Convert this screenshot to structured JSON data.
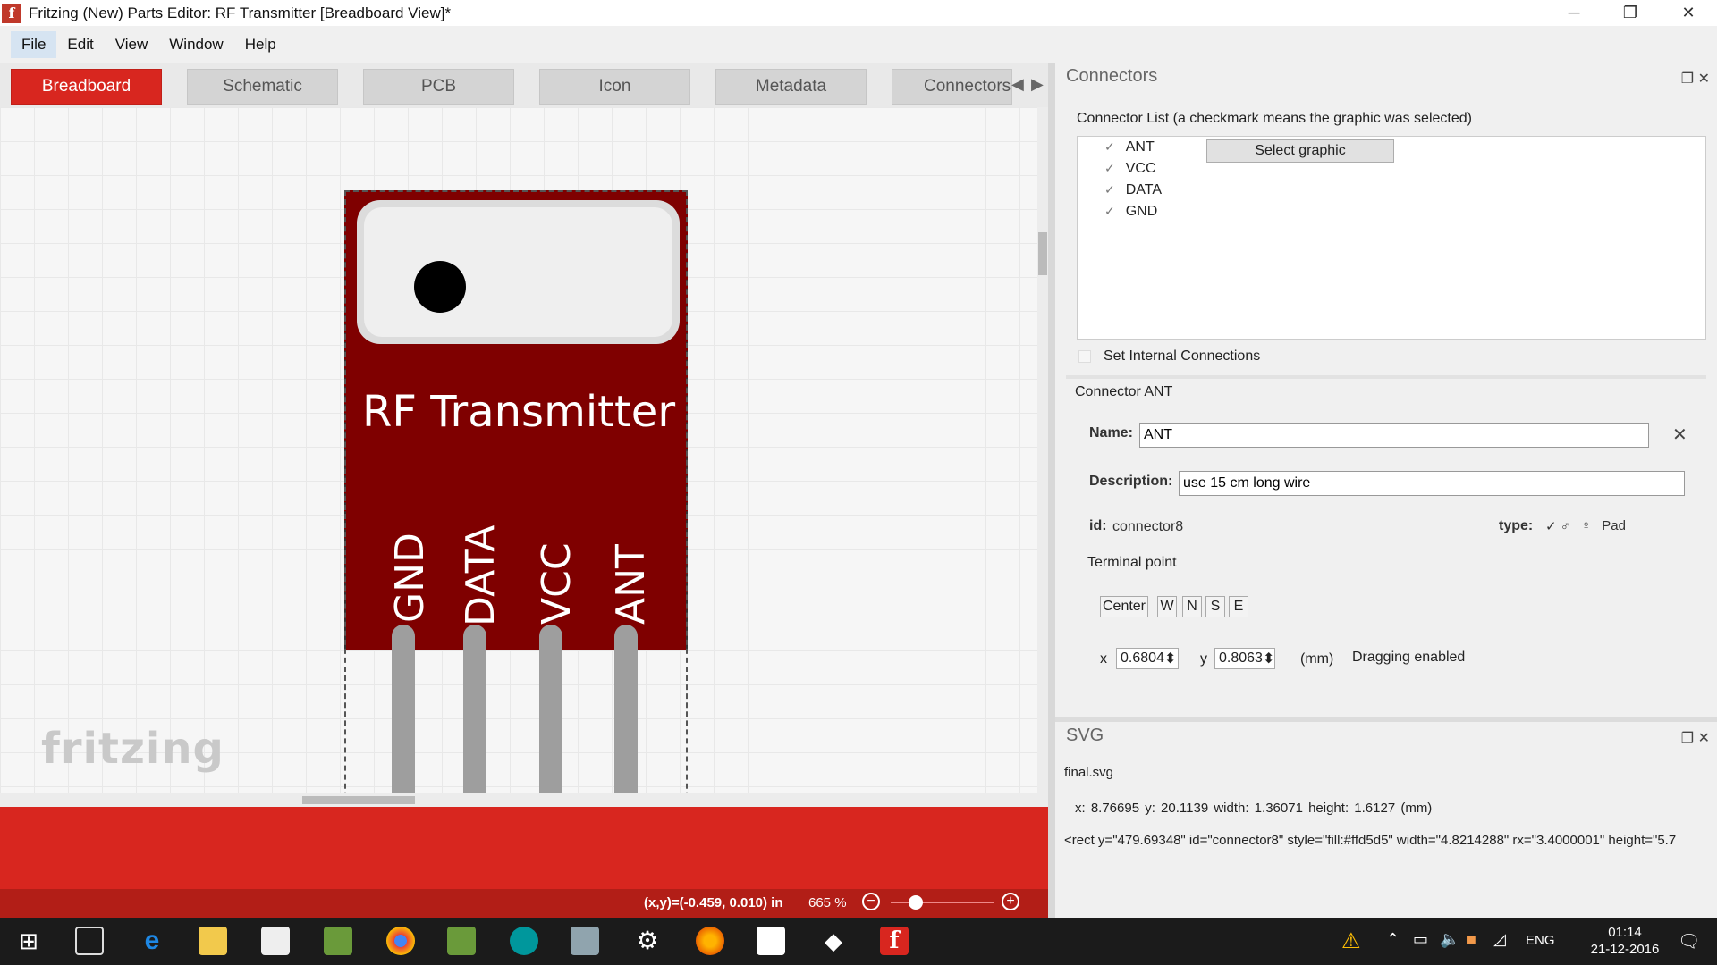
{
  "window": {
    "title": "Fritzing (New) Parts Editor: RF Transmitter [Breadboard View]*",
    "app_icon": "f"
  },
  "menu": [
    "File",
    "Edit",
    "View",
    "Window",
    "Help"
  ],
  "tabs": [
    "Breadboard",
    "Schematic",
    "PCB",
    "Icon",
    "Metadata",
    "Connectors"
  ],
  "part": {
    "name": "RF Transmitter",
    "pins": [
      "GND",
      "DATA",
      "VCC",
      "ANT"
    ]
  },
  "logo": "fritzing",
  "status": {
    "coords": "(x,y)=(-0.459, 0.010) in",
    "zoom": "665 %"
  },
  "connectors_panel": {
    "title": "Connectors",
    "list_label": "Connector List (a checkmark means the graphic was selected)",
    "items": [
      "ANT",
      "VCC",
      "DATA",
      "GND"
    ],
    "select_graphic": "Select graphic",
    "internal_connections": "Set Internal Connections",
    "connector_title": "Connector ANT",
    "name_label": "Name:",
    "name_value": "ANT",
    "description_label": "Description:",
    "description_value": "use 15 cm long wire",
    "id_label": "id:",
    "id_value": "connector8",
    "type_label": "type:",
    "type_pad": "Pad",
    "terminal_point": "Terminal point",
    "terminal_buttons": [
      "Center",
      "W",
      "N",
      "S",
      "E"
    ],
    "x_label": "x",
    "x_value": "0.6804",
    "y_label": "y",
    "y_value": "0.8063",
    "unit": "(mm)",
    "dragging": "Dragging enabled"
  },
  "svg_panel": {
    "title": "SVG",
    "file": "final.svg",
    "geometry": "x:  8.76695     y:  20.1139     width:  1.36071     height:  1.6127     (mm)",
    "code": "<rect  y=\"479.69348\" id=\"connector8\" style=\"fill:#ffd5d5\" width=\"4.8214288\" rx=\"3.4000001\" height=\"5.7"
  },
  "taskbar": {
    "time": "01:14",
    "date": "21-12-2016",
    "lang": "ENG"
  },
  "colors": {
    "accent_red": "#d8261f",
    "part_body": "#7f0000",
    "selected_pad": "#8e67e6"
  }
}
